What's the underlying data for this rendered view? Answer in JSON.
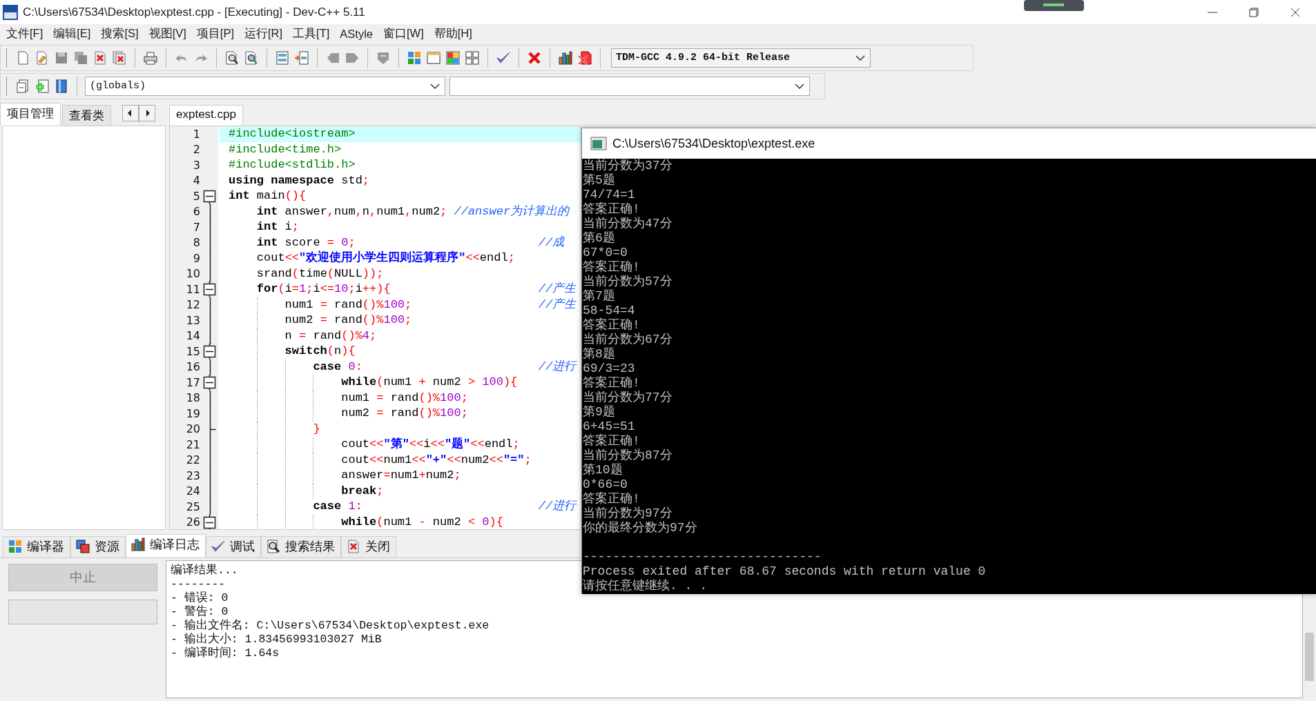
{
  "window": {
    "title": "C:\\Users\\67534\\Desktop\\exptest.cpp - [Executing] - Dev-C++ 5.11"
  },
  "menu": [
    "文件[F]",
    "编辑[E]",
    "搜索[S]",
    "视图[V]",
    "项目[P]",
    "运行[R]",
    "工具[T]",
    "AStyle",
    "窗口[W]",
    "帮助[H]"
  ],
  "toolbar": {
    "compiler": "TDM-GCC 4.9.2 64-bit Release",
    "scope": "(globals)"
  },
  "left_panel": {
    "tabs": [
      {
        "label": "项目管理",
        "selected": true
      },
      {
        "label": "查看类",
        "selected": false
      }
    ]
  },
  "editor": {
    "tabs": [
      {
        "label": "exptest.cpp",
        "selected": true
      }
    ],
    "lines": [
      {
        "number": "1",
        "current": true,
        "kind": "plain",
        "tokens": [
          {
            "kind": "pre",
            "text": "#include<iostream>"
          }
        ]
      },
      {
        "number": "2",
        "current": false,
        "kind": "plain",
        "tokens": [
          {
            "kind": "pre",
            "text": "#include<time.h>"
          }
        ]
      },
      {
        "number": "3",
        "current": false,
        "kind": "plain",
        "tokens": [
          {
            "kind": "pre",
            "text": "#include<stdlib.h>"
          }
        ]
      },
      {
        "number": "4",
        "current": false,
        "kind": "plain",
        "tokens": [
          {
            "kind": "kw",
            "text": "using namespace"
          },
          {
            "kind": "id",
            "text": " std"
          },
          {
            "kind": "sym",
            "text": ";"
          }
        ]
      },
      {
        "number": "5",
        "current": false,
        "kind": "fold_start",
        "tokens": [
          {
            "kind": "kw",
            "text": "int"
          },
          {
            "kind": "id",
            "text": " main"
          },
          {
            "kind": "sym",
            "text": "(){"
          }
        ]
      },
      {
        "number": "6",
        "current": false,
        "kind": "fold_body",
        "tokens": [
          {
            "kind": "kw",
            "text": "    int"
          },
          {
            "kind": "id",
            "text": " answer"
          },
          {
            "kind": "sym",
            "text": ","
          },
          {
            "kind": "id",
            "text": "num"
          },
          {
            "kind": "sym",
            "text": ","
          },
          {
            "kind": "id",
            "text": "n"
          },
          {
            "kind": "sym",
            "text": ","
          },
          {
            "kind": "id",
            "text": "num1"
          },
          {
            "kind": "sym",
            "text": ","
          },
          {
            "kind": "id",
            "text": "num2"
          },
          {
            "kind": "sym",
            "text": ";"
          },
          {
            "kind": "comment",
            "text": " //answer为计算出的"
          }
        ]
      },
      {
        "number": "7",
        "current": false,
        "kind": "fold_body",
        "tokens": [
          {
            "kind": "kw",
            "text": "    int"
          },
          {
            "kind": "id",
            "text": " i"
          },
          {
            "kind": "sym",
            "text": ";"
          }
        ]
      },
      {
        "number": "8",
        "current": false,
        "kind": "fold_body",
        "tokens": [
          {
            "kind": "kw",
            "text": "    int"
          },
          {
            "kind": "id",
            "text": " score "
          },
          {
            "kind": "sym",
            "text": "="
          },
          {
            "kind": "num",
            "text": " 0"
          },
          {
            "kind": "sym",
            "text": ";"
          },
          {
            "kind": "comment_col",
            "text": "//成"
          }
        ]
      },
      {
        "number": "9",
        "current": false,
        "kind": "fold_body",
        "tokens": [
          {
            "kind": "id",
            "text": "    cout"
          },
          {
            "kind": "sym",
            "text": "<<"
          },
          {
            "kind": "str",
            "text": "\"欢迎使用小学生四则运算程序\""
          },
          {
            "kind": "sym",
            "text": "<<"
          },
          {
            "kind": "id",
            "text": "endl"
          },
          {
            "kind": "sym",
            "text": ";"
          }
        ]
      },
      {
        "number": "10",
        "current": false,
        "kind": "fold_body",
        "tokens": [
          {
            "kind": "id",
            "text": "    srand"
          },
          {
            "kind": "sym",
            "text": "("
          },
          {
            "kind": "id",
            "text": "time"
          },
          {
            "kind": "sym",
            "text": "("
          },
          {
            "kind": "id",
            "text": "NULL"
          },
          {
            "kind": "sym",
            "text": "));"
          }
        ]
      },
      {
        "number": "11",
        "current": false,
        "kind": "fold_start",
        "tokens": [
          {
            "kind": "kw",
            "text": "    for"
          },
          {
            "kind": "sym",
            "text": "("
          },
          {
            "kind": "id",
            "text": "i"
          },
          {
            "kind": "sym",
            "text": "="
          },
          {
            "kind": "num",
            "text": "1"
          },
          {
            "kind": "sym",
            "text": ";"
          },
          {
            "kind": "id",
            "text": "i"
          },
          {
            "kind": "sym",
            "text": "<="
          },
          {
            "kind": "num",
            "text": "10"
          },
          {
            "kind": "sym",
            "text": ";"
          },
          {
            "kind": "id",
            "text": "i"
          },
          {
            "kind": "sym",
            "text": "++){"
          },
          {
            "kind": "comment_col",
            "text": "//产生"
          }
        ]
      },
      {
        "number": "12",
        "current": false,
        "kind": "fold_body",
        "tokens": [
          {
            "kind": "id",
            "text": "        num1 "
          },
          {
            "kind": "sym",
            "text": "="
          },
          {
            "kind": "id",
            "text": " rand"
          },
          {
            "kind": "sym",
            "text": "()%"
          },
          {
            "kind": "num",
            "text": "100"
          },
          {
            "kind": "sym",
            "text": ";"
          },
          {
            "kind": "comment_col",
            "text": "//产生"
          }
        ]
      },
      {
        "number": "13",
        "current": false,
        "kind": "fold_body",
        "tokens": [
          {
            "kind": "id",
            "text": "        num2 "
          },
          {
            "kind": "sym",
            "text": "="
          },
          {
            "kind": "id",
            "text": " rand"
          },
          {
            "kind": "sym",
            "text": "()%"
          },
          {
            "kind": "num",
            "text": "100"
          },
          {
            "kind": "sym",
            "text": ";"
          }
        ]
      },
      {
        "number": "14",
        "current": false,
        "kind": "fold_body",
        "tokens": [
          {
            "kind": "id",
            "text": "        n "
          },
          {
            "kind": "sym",
            "text": "="
          },
          {
            "kind": "id",
            "text": " rand"
          },
          {
            "kind": "sym",
            "text": "()%"
          },
          {
            "kind": "num",
            "text": "4"
          },
          {
            "kind": "sym",
            "text": ";"
          }
        ]
      },
      {
        "number": "15",
        "current": false,
        "kind": "fold_start",
        "tokens": [
          {
            "kind": "kw",
            "text": "        switch"
          },
          {
            "kind": "sym",
            "text": "("
          },
          {
            "kind": "id",
            "text": "n"
          },
          {
            "kind": "sym",
            "text": "){"
          }
        ]
      },
      {
        "number": "16",
        "current": false,
        "kind": "fold_body",
        "tokens": [
          {
            "kind": "kw",
            "text": "            case"
          },
          {
            "kind": "num",
            "text": " 0"
          },
          {
            "kind": "sym",
            "text": ":"
          },
          {
            "kind": "comment_col",
            "text": "//进行"
          }
        ]
      },
      {
        "number": "17",
        "current": false,
        "kind": "fold_start",
        "tokens": [
          {
            "kind": "kw",
            "text": "                while"
          },
          {
            "kind": "sym",
            "text": "("
          },
          {
            "kind": "id",
            "text": "num1 "
          },
          {
            "kind": "sym",
            "text": "+"
          },
          {
            "kind": "id",
            "text": " num2 "
          },
          {
            "kind": "sym",
            "text": ">"
          },
          {
            "kind": "num",
            "text": " 100"
          },
          {
            "kind": "sym",
            "text": "){"
          }
        ]
      },
      {
        "number": "18",
        "current": false,
        "kind": "fold_body",
        "tokens": [
          {
            "kind": "id",
            "text": "                num1 "
          },
          {
            "kind": "sym",
            "text": "="
          },
          {
            "kind": "id",
            "text": " rand"
          },
          {
            "kind": "sym",
            "text": "()%"
          },
          {
            "kind": "num",
            "text": "100"
          },
          {
            "kind": "sym",
            "text": ";"
          }
        ]
      },
      {
        "number": "19",
        "current": false,
        "kind": "fold_body",
        "tokens": [
          {
            "kind": "id",
            "text": "                num2 "
          },
          {
            "kind": "sym",
            "text": "="
          },
          {
            "kind": "id",
            "text": " rand"
          },
          {
            "kind": "sym",
            "text": "()%"
          },
          {
            "kind": "num",
            "text": "100"
          },
          {
            "kind": "sym",
            "text": ";"
          }
        ]
      },
      {
        "number": "20",
        "current": false,
        "kind": "fold_end",
        "tokens": [
          {
            "kind": "sym",
            "text": "            }"
          }
        ]
      },
      {
        "number": "21",
        "current": false,
        "kind": "fold_body",
        "tokens": [
          {
            "kind": "id",
            "text": "                cout"
          },
          {
            "kind": "sym",
            "text": "<<"
          },
          {
            "kind": "str",
            "text": "\"第\""
          },
          {
            "kind": "sym",
            "text": "<<"
          },
          {
            "kind": "id",
            "text": "i"
          },
          {
            "kind": "sym",
            "text": "<<"
          },
          {
            "kind": "str",
            "text": "\"题\""
          },
          {
            "kind": "sym",
            "text": "<<"
          },
          {
            "kind": "id",
            "text": "endl"
          },
          {
            "kind": "sym",
            "text": ";"
          }
        ]
      },
      {
        "number": "22",
        "current": false,
        "kind": "fold_body",
        "tokens": [
          {
            "kind": "id",
            "text": "                cout"
          },
          {
            "kind": "sym",
            "text": "<<"
          },
          {
            "kind": "id",
            "text": "num1"
          },
          {
            "kind": "sym",
            "text": "<<"
          },
          {
            "kind": "str",
            "text": "\"+\""
          },
          {
            "kind": "sym",
            "text": "<<"
          },
          {
            "kind": "id",
            "text": "num2"
          },
          {
            "kind": "sym",
            "text": "<<"
          },
          {
            "kind": "str",
            "text": "\"=\""
          },
          {
            "kind": "sym",
            "text": ";"
          }
        ]
      },
      {
        "number": "23",
        "current": false,
        "kind": "fold_body",
        "tokens": [
          {
            "kind": "id",
            "text": "                answer"
          },
          {
            "kind": "sym",
            "text": "="
          },
          {
            "kind": "id",
            "text": "num1"
          },
          {
            "kind": "sym",
            "text": "+"
          },
          {
            "kind": "id",
            "text": "num2"
          },
          {
            "kind": "sym",
            "text": ";"
          }
        ]
      },
      {
        "number": "24",
        "current": false,
        "kind": "fold_body",
        "tokens": [
          {
            "kind": "kw",
            "text": "                break"
          },
          {
            "kind": "sym",
            "text": ";"
          }
        ]
      },
      {
        "number": "25",
        "current": false,
        "kind": "fold_body",
        "tokens": [
          {
            "kind": "kw",
            "text": "            case"
          },
          {
            "kind": "num",
            "text": " 1"
          },
          {
            "kind": "sym",
            "text": ":"
          },
          {
            "kind": "comment_col",
            "text": "//进行"
          }
        ]
      },
      {
        "number": "26",
        "current": false,
        "kind": "fold_start",
        "tokens": [
          {
            "kind": "kw",
            "text": "                while"
          },
          {
            "kind": "sym",
            "text": "("
          },
          {
            "kind": "id",
            "text": "num1 "
          },
          {
            "kind": "sym",
            "text": "-"
          },
          {
            "kind": "id",
            "text": " num2 "
          },
          {
            "kind": "sym",
            "text": "<"
          },
          {
            "kind": "num",
            "text": " 0"
          },
          {
            "kind": "sym",
            "text": "){"
          }
        ]
      }
    ]
  },
  "console": {
    "title": "C:\\Users\\67534\\Desktop\\exptest.exe",
    "lines": [
      {
        "text": "当前分数为37分"
      },
      {
        "text": "第5题"
      },
      {
        "text": "74/74=1"
      },
      {
        "text": "答案正确!"
      },
      {
        "text": "当前分数为47分"
      },
      {
        "text": "第6题"
      },
      {
        "text": "67*0=0"
      },
      {
        "text": "答案正确!"
      },
      {
        "text": "当前分数为57分"
      },
      {
        "text": "第7题"
      },
      {
        "text": "58-54=4"
      },
      {
        "text": "答案正确!"
      },
      {
        "text": "当前分数为67分"
      },
      {
        "text": "第8题"
      },
      {
        "text": "69/3=23"
      },
      {
        "text": "答案正确!"
      },
      {
        "text": "当前分数为77分"
      },
      {
        "text": "第9题"
      },
      {
        "text": "6+45=51"
      },
      {
        "text": "答案正确!"
      },
      {
        "text": "当前分数为87分"
      },
      {
        "text": "第10题"
      },
      {
        "text": "0*66=0"
      },
      {
        "text": "答案正确!"
      },
      {
        "text": "当前分数为97分"
      },
      {
        "text": "你的最终分数为97分"
      },
      {
        "text": "--------------------------------",
        "blank_before": true
      },
      {
        "text": "Process exited after 68.67 seconds with return value 0"
      },
      {
        "text": "请按任意键继续. . ."
      }
    ]
  },
  "bottom": {
    "tabs": [
      {
        "label": "编译器",
        "selected": false
      },
      {
        "label": "资源",
        "selected": false
      },
      {
        "label": "编译日志",
        "selected": true
      },
      {
        "label": "调试",
        "selected": false
      },
      {
        "label": "搜索结果",
        "selected": false
      },
      {
        "label": "关闭",
        "selected": false
      }
    ],
    "stop_button": {
      "label": "中止",
      "disabled": true
    },
    "progress": {
      "level": 0
    },
    "log": [
      "编译结果...",
      "--------",
      "- 错误: 0",
      "- 警告: 0",
      "- 输出文件名: C:\\Users\\67534\\Desktop\\exptest.exe",
      "- 输出大小: 1.83456993103027 MiB",
      "- 编译时间: 1.64s"
    ]
  }
}
